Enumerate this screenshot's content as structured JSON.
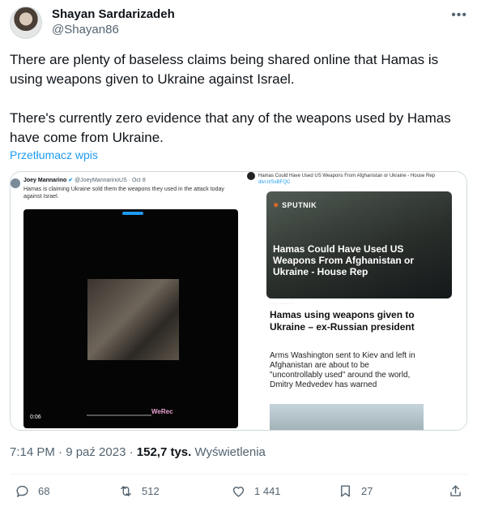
{
  "author": {
    "name": "Shayan Sardarizadeh",
    "handle": "@Shayan86"
  },
  "more_icon": "more-horizontal-icon",
  "tweet": {
    "paragraph1": "There are plenty of baseless claims being shared online that Hamas is using weapons given to Ukraine against Israel.",
    "paragraph2": "There's currently zero evidence that any of the weapons used by Hamas have come from Ukraine."
  },
  "translate_label": "Przetłumacz wpis",
  "media": {
    "left": {
      "name": "Joey Mannarino",
      "handle_date": "@JoeyMannarinoUS · Oct 8",
      "text": "Hamas is claiming Ukraine sold them the weapons they used in the attack today against Israel.",
      "video_time": "0:06",
      "watermark": "WeRec"
    },
    "right": {
      "top_text": "Hamas Could Have Used US Weapons From Afghanistan or Ukraine - House Rep",
      "top_link": "dlvr.it/SxBFQC",
      "sputnik_logo": "SPUTNIK",
      "sputnik_headline": "Hamas Could Have Used US Weapons From Afghanistan or Ukraine - House Rep",
      "article_title": "Hamas using weapons given to Ukraine – ex-Russian president",
      "article_body": "Arms Washington sent to Kiev and left in Afghanistan are about to be \"uncontrollably used\" around the world, Dmitry Medvedev has warned"
    }
  },
  "timestamp": {
    "time_date": "7:14 PM · 9 paź 2023 · ",
    "views_count": "152,7 tys.",
    "views_label": " Wyświetlenia"
  },
  "actions": {
    "reply_count": "68",
    "retweet_count": "512",
    "like_count": "1 441",
    "bookmark_count": "27"
  },
  "colors": {
    "link": "#1d9bf0",
    "secondary_text": "#536471",
    "primary_text": "#0f1419"
  }
}
